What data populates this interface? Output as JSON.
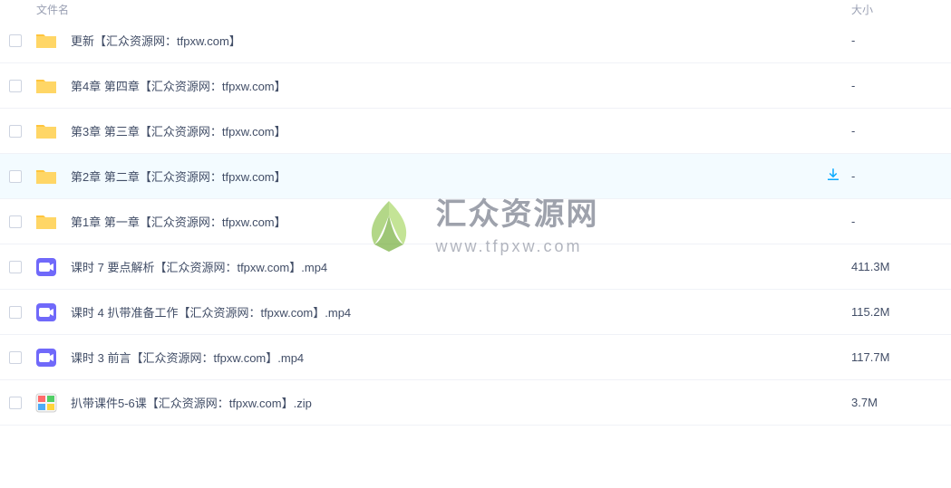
{
  "header": {
    "name_col": "文件名",
    "size_col": "大小"
  },
  "files": [
    {
      "type": "folder",
      "name": "更新【汇众资源网：tfpxw.com】",
      "size": "-",
      "hovered": false
    },
    {
      "type": "folder",
      "name": "第4章 第四章【汇众资源网：tfpxw.com】",
      "size": "-",
      "hovered": false
    },
    {
      "type": "folder",
      "name": "第3章 第三章【汇众资源网：tfpxw.com】",
      "size": "-",
      "hovered": false
    },
    {
      "type": "folder",
      "name": "第2章 第二章【汇众资源网：tfpxw.com】",
      "size": "-",
      "hovered": true
    },
    {
      "type": "folder",
      "name": "第1章 第一章【汇众资源网：tfpxw.com】",
      "size": "-",
      "hovered": false
    },
    {
      "type": "video",
      "name": "课时 7 要点解析【汇众资源网：tfpxw.com】.mp4",
      "size": "411.3M",
      "hovered": false
    },
    {
      "type": "video",
      "name": "课时 4 扒带准备工作【汇众资源网：tfpxw.com】.mp4",
      "size": "115.2M",
      "hovered": false
    },
    {
      "type": "video",
      "name": "课时 3 前言【汇众资源网：tfpxw.com】.mp4",
      "size": "117.7M",
      "hovered": false
    },
    {
      "type": "zip",
      "name": "扒带课件5-6课【汇众资源网：tfpxw.com】.zip",
      "size": "3.7M",
      "hovered": false
    }
  ],
  "watermark": {
    "title": "汇众资源网",
    "url": "www.tfpxw.com"
  },
  "icons": {
    "folder_color": "#ffd666",
    "folder_tab": "#ffc53d",
    "video_color": "#7069fa",
    "zip_bg": "#fff",
    "download_color": "#09aaff"
  }
}
